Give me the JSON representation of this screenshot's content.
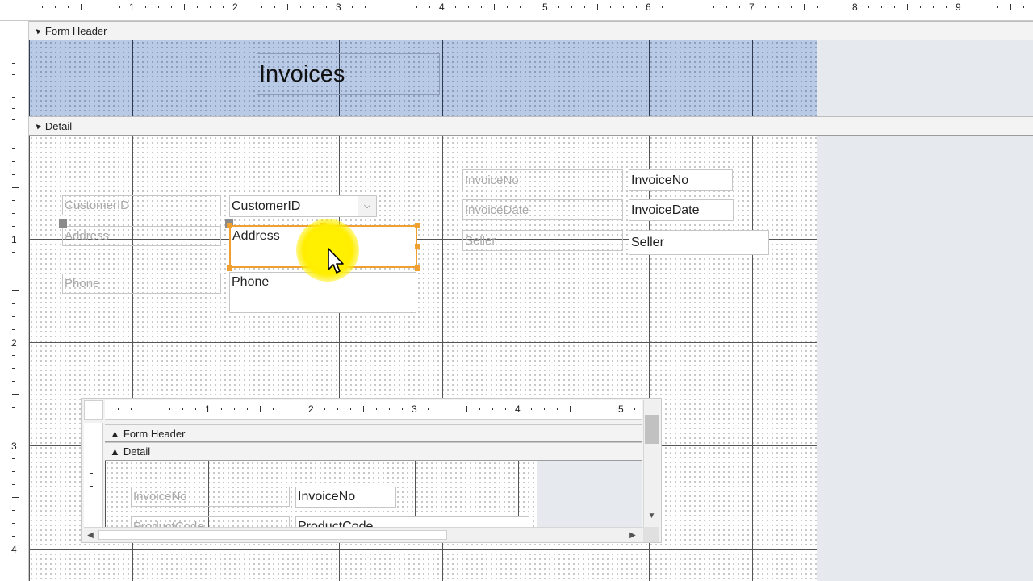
{
  "top_ruler": {
    "marks": [
      "1",
      "2",
      "3",
      "4",
      "5",
      "6",
      "7",
      "8",
      "9"
    ]
  },
  "left_ruler": {
    "marks": [
      "1",
      "2",
      "3",
      "4"
    ]
  },
  "sections": {
    "form_header": "Form Header",
    "detail": "Detail"
  },
  "header": {
    "title": "Invoices"
  },
  "detail": {
    "customer_id": {
      "label": "CustomerID",
      "control": "CustomerID"
    },
    "address": {
      "label": "Address",
      "control": "Address"
    },
    "phone": {
      "label": "Phone",
      "control": "Phone"
    },
    "invoice_no": {
      "label": "InvoiceNo",
      "control": "InvoiceNo"
    },
    "invoice_date": {
      "label": "InvoiceDate",
      "control": "InvoiceDate"
    },
    "seller": {
      "label": "Seller",
      "control": "Seller"
    }
  },
  "subform": {
    "ruler_marks": [
      "1",
      "2",
      "3",
      "4",
      "5"
    ],
    "form_header": "Form Header",
    "detail": "Detail",
    "invoice_no": {
      "label": "InvoiceNo",
      "control": "InvoiceNo"
    },
    "product_code": {
      "label": "ProductCode",
      "control": "ProductCode"
    }
  },
  "colors": {
    "header_bg": "#b9cae6",
    "selection_handle": "#f0a030",
    "cursor_highlight": "#ffee00"
  }
}
